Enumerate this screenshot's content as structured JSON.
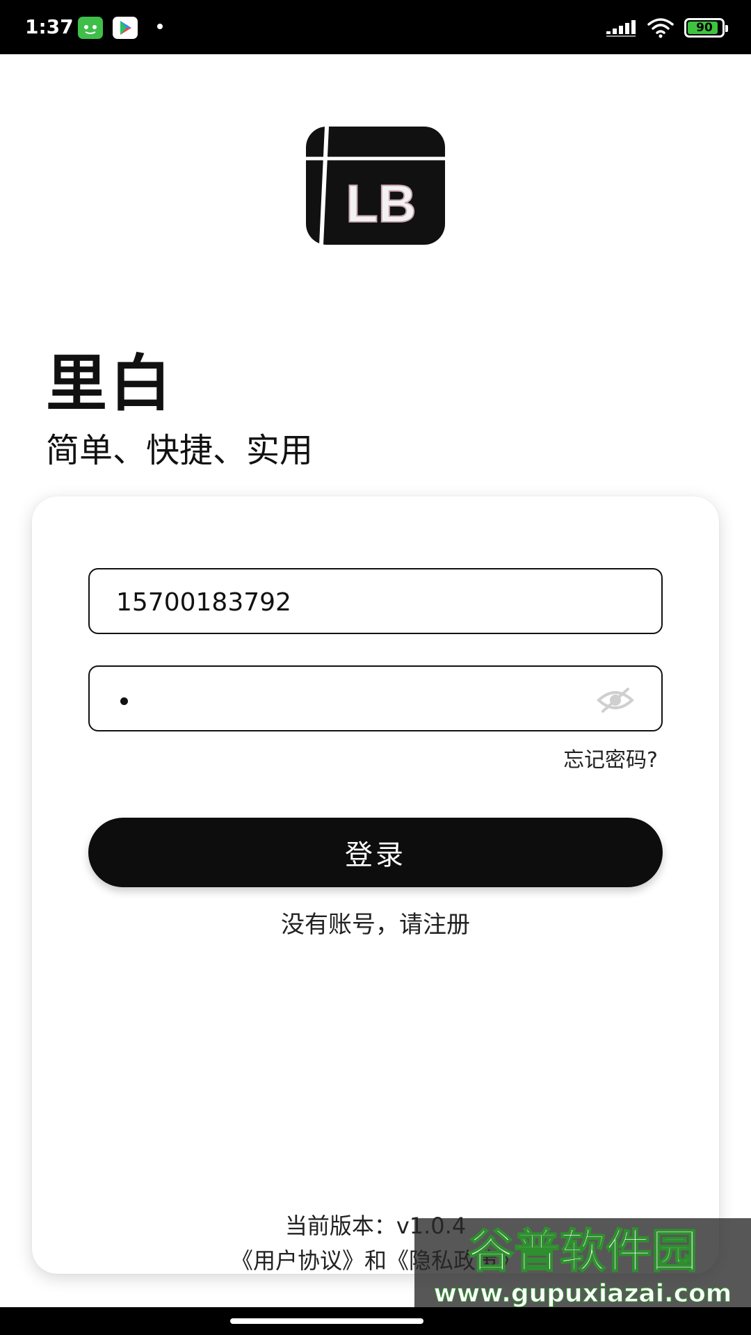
{
  "status_bar": {
    "time": "1:37",
    "battery_level": "90",
    "battery_fraction": 0.9,
    "icons": [
      "game-app-icon",
      "play-store-icon",
      "notification-dot",
      "signal-icon",
      "wifi-icon",
      "battery-icon"
    ]
  },
  "header": {
    "logo_text": "LB",
    "title": "里白",
    "slogan": "简单、快捷、实用"
  },
  "form": {
    "phone_value": "15700183792",
    "password_masked": "•",
    "password_visibility_icon": "eye-off-icon",
    "forgot_label": "忘记密码?",
    "login_label": "登录",
    "register_label": "没有账号，请注册"
  },
  "footer": {
    "version": "当前版本：v1.0.4",
    "agreement_prefix": "《用户协议》和",
    "privacy_link": "《隐私政策》"
  },
  "watermark": {
    "title": "谷普软件园",
    "url": "www.gupuxiazai.com"
  },
  "colors": {
    "primary": "#0d0d0d",
    "background": "#ffffff",
    "battery": "#3ec43e"
  }
}
